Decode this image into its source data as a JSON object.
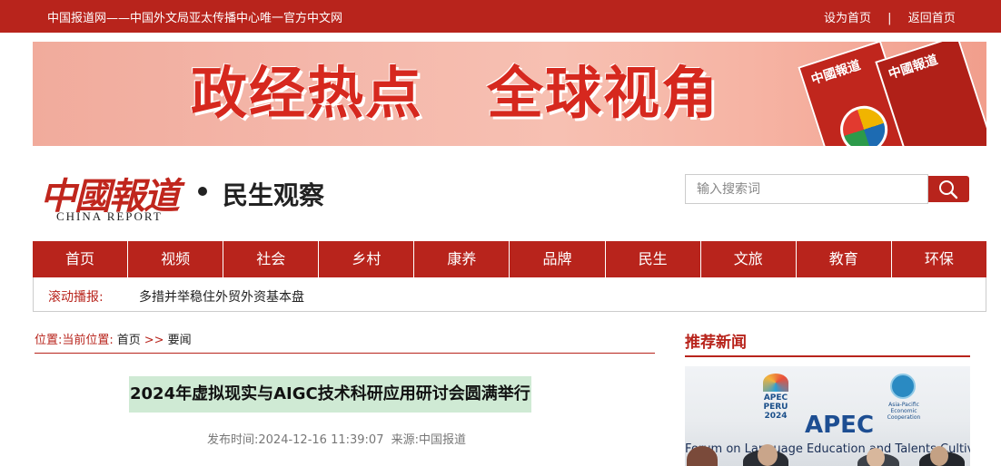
{
  "topbar": {
    "site_text": "中国报道网——中国外文局亚太传播中心唯一官方中文网",
    "set_home": "设为首页",
    "separator": "|",
    "back_home": "返回首页"
  },
  "banner": {
    "slogan_left": "政经热点",
    "slogan_right": "全球视角",
    "magazine_masthead": "中國報道"
  },
  "logo": {
    "chinese": "中國報道",
    "english": "CHINA  REPORT"
  },
  "channel": {
    "name": "民生观察"
  },
  "search": {
    "placeholder": "输入搜索词",
    "icon": "search-icon"
  },
  "nav": {
    "items": [
      {
        "label": "首页"
      },
      {
        "label": "视频"
      },
      {
        "label": "社会"
      },
      {
        "label": "乡村"
      },
      {
        "label": "康养"
      },
      {
        "label": "品牌"
      },
      {
        "label": "民生"
      },
      {
        "label": "文旅"
      },
      {
        "label": "教育"
      },
      {
        "label": "环保"
      }
    ]
  },
  "ticker": {
    "label": "滚动播报:",
    "text": "多措并举稳住外贸外资基本盘"
  },
  "breadcrumb": {
    "prefix": "位置:当前位置:",
    "home": "首页",
    "arrow": ">>",
    "current": "要闻"
  },
  "article": {
    "title": "2024年虚拟现实与AIGC技术科研应用研讨会圆满举行",
    "published_label": "发布时间:",
    "published_time": "2024-12-16 11:39:07",
    "source_label": "来源:",
    "source": "中国报道"
  },
  "sidebar": {
    "recommended_title": "推荐新闻",
    "image": {
      "apec_peru": "APEC PERU",
      "apec_peru_year": "2024",
      "apec_logo_text": "Asia-Pacific Economic Cooperation",
      "apec_big": "APEC",
      "forum_text": "Forum on Language Education and Talents Cultivat"
    }
  },
  "colors": {
    "brand_red": "#b8241c",
    "title_highlight": "#cfead4"
  }
}
